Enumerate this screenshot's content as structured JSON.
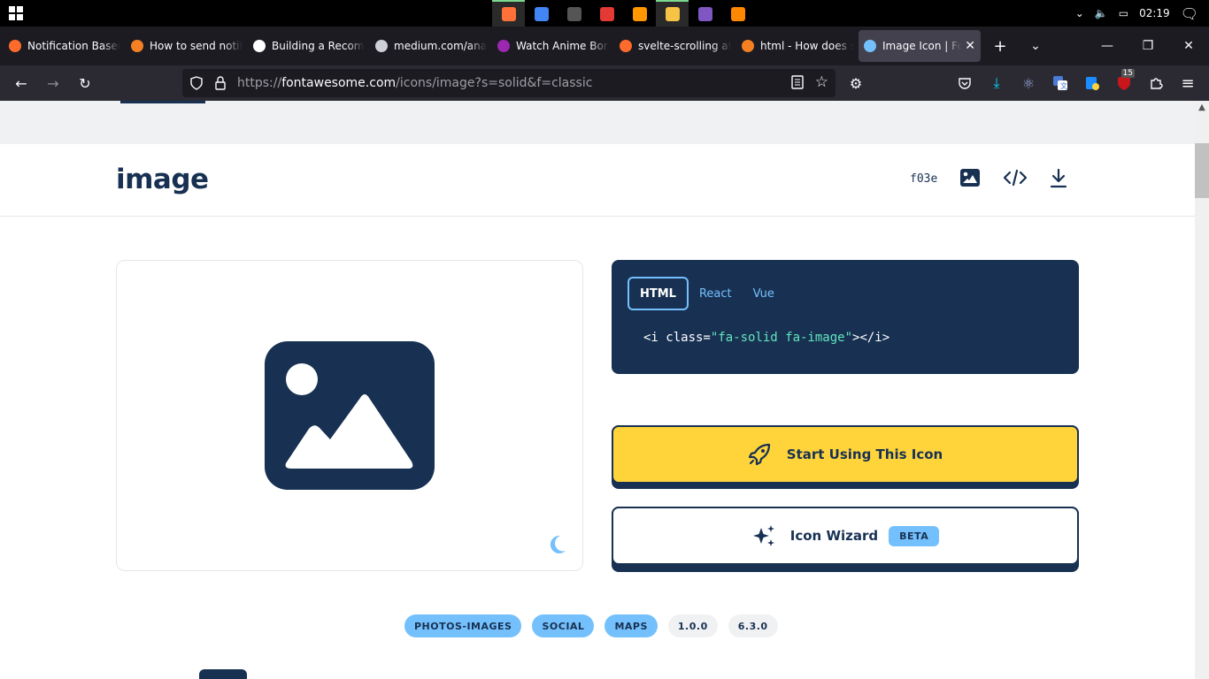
{
  "taskbar": {
    "apps": [
      {
        "name": "firefox",
        "color": "#ff7139",
        "active": true
      },
      {
        "name": "chrome",
        "color": "#4285f4",
        "active": false
      },
      {
        "name": "terminal",
        "color": "#555555",
        "active": false
      },
      {
        "name": "wps",
        "color": "#e53935",
        "active": false
      },
      {
        "name": "sublime",
        "color": "#ff9800",
        "active": false
      },
      {
        "name": "explorer",
        "color": "#f6c344",
        "active": true
      },
      {
        "name": "app-purple",
        "color": "#7e57c2",
        "active": false
      },
      {
        "name": "vlc",
        "color": "#ff8800",
        "active": false
      }
    ],
    "time": "02:19"
  },
  "tabs": [
    {
      "title": "Notification Based",
      "fav": "#ff6b2b",
      "active": false
    },
    {
      "title": "How to send notif",
      "fav": "#f48024",
      "active": false
    },
    {
      "title": "Building a Recom",
      "fav": "#ffffff",
      "active": false
    },
    {
      "title": "medium.com/ana",
      "fav": "#cfcfd8",
      "active": false
    },
    {
      "title": "Watch Anime Bor",
      "fav": "#9c27b0",
      "active": false
    },
    {
      "title": "svelte-scrolling at",
      "fav": "#ff6b2b",
      "active": false
    },
    {
      "title": "html - How does s",
      "fav": "#f48024",
      "active": false
    },
    {
      "title": "Image Icon | Fo",
      "fav": "#74c0fc",
      "active": true
    }
  ],
  "url": {
    "prefix": "https://",
    "domain": "fontawesome.com",
    "path": "/icons/image?s=solid&f=classic"
  },
  "badge_count": "15",
  "icon": {
    "name": "image",
    "unicode": "f03e",
    "code_tabs": [
      "HTML",
      "React",
      "Vue"
    ],
    "code_prefix": "<i class=",
    "code_value": "\"fa-solid fa-image\"",
    "code_suffix": "></i>",
    "start_label": "Start Using This Icon",
    "wizard_label": "Icon Wizard",
    "beta_label": "BETA",
    "tags": [
      {
        "label": "PHOTOS-IMAGES",
        "style": "blue"
      },
      {
        "label": "SOCIAL",
        "style": "blue"
      },
      {
        "label": "MAPS",
        "style": "blue"
      },
      {
        "label": "1.0.0",
        "style": "gray"
      },
      {
        "label": "6.3.0",
        "style": "gray"
      }
    ]
  },
  "colors": {
    "navy": "#183153",
    "yellow": "#ffd43b",
    "lightblue": "#74c0fc"
  }
}
